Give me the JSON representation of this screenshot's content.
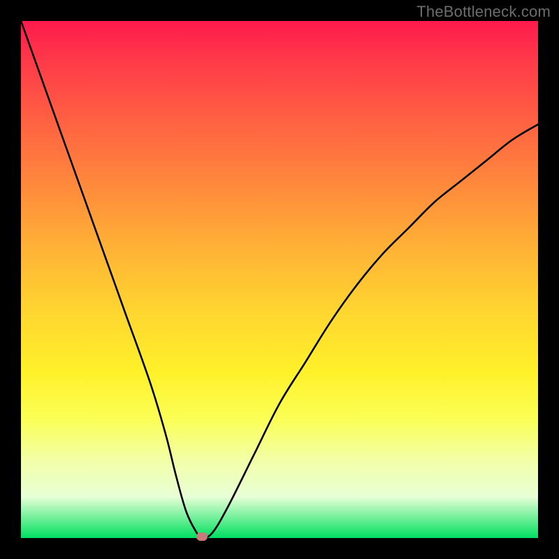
{
  "watermark": {
    "text": "TheBottleneck.com"
  },
  "chart_data": {
    "type": "line",
    "title": "",
    "xlabel": "",
    "ylabel": "",
    "xlim": [
      0,
      100
    ],
    "ylim": [
      0,
      100
    ],
    "background_gradient": {
      "orientation": "vertical",
      "stops": [
        {
          "pos": 0,
          "color": "#ff1a4d"
        },
        {
          "pos": 20,
          "color": "#ff6342"
        },
        {
          "pos": 44,
          "color": "#ffb236"
        },
        {
          "pos": 68,
          "color": "#fff12a"
        },
        {
          "pos": 85,
          "color": "#f2ffa8"
        },
        {
          "pos": 100,
          "color": "#00e060"
        }
      ]
    },
    "series": [
      {
        "name": "bottleneck-curve",
        "x": [
          0,
          5,
          10,
          15,
          20,
          25,
          28,
          30,
          32,
          34,
          35,
          37,
          40,
          45,
          50,
          55,
          60,
          65,
          70,
          75,
          80,
          85,
          90,
          95,
          100
        ],
        "y": [
          100,
          86,
          72,
          58,
          44,
          30,
          20,
          12,
          5,
          1,
          0,
          1,
          6,
          16,
          26,
          34,
          42,
          49,
          55,
          60,
          65,
          69,
          73,
          77,
          80
        ]
      }
    ],
    "marker": {
      "x": 35,
      "y": 0,
      "shape": "rounded-rect",
      "color": "#c97a7a"
    },
    "annotations": []
  }
}
